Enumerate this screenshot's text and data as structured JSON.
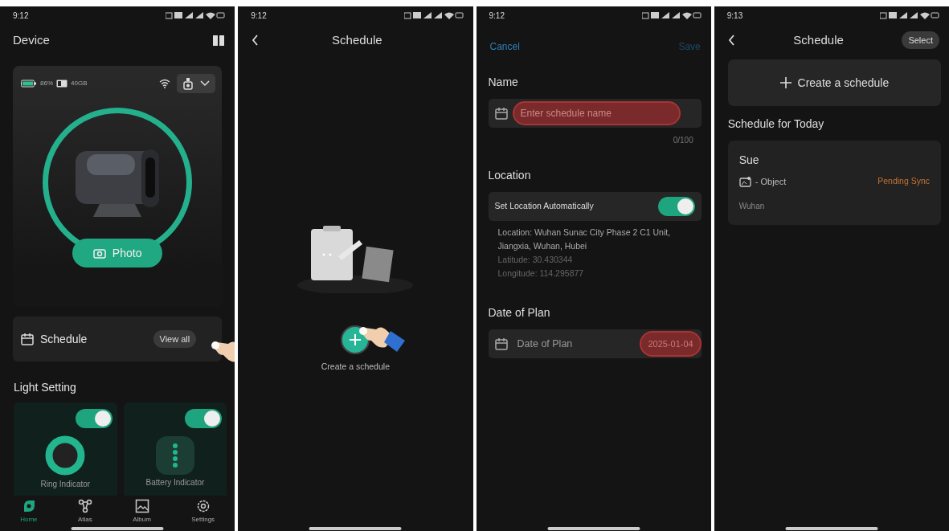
{
  "screens": [
    {
      "kind": "device",
      "status_time": "9:12",
      "title": "Device",
      "battery": "86%",
      "storage": "40GB",
      "photo_button": "Photo",
      "schedule": {
        "label": "Schedule",
        "action": "View all"
      },
      "light_heading": "Light Setting",
      "lights": [
        {
          "kind": "ring",
          "label": "Ring Indicator",
          "on": true
        },
        {
          "kind": "battery",
          "label": "Battery Indicator",
          "on": true
        }
      ],
      "nav": [
        {
          "kind": "home",
          "label": "Home",
          "selected": true
        },
        {
          "kind": "atlas",
          "label": "Atlas",
          "selected": false
        },
        {
          "kind": "album",
          "label": "Album",
          "selected": false
        },
        {
          "kind": "settings",
          "label": "Settings",
          "selected": false
        }
      ]
    },
    {
      "kind": "empty",
      "status_time": "9:12",
      "title": "Schedule",
      "create_label": "Create a schedule"
    },
    {
      "kind": "form",
      "status_time": "9:12",
      "cancel": "Cancel",
      "save": {
        "label": "Save",
        "disabled": true
      },
      "name": {
        "heading": "Name",
        "placeholder": "Enter schedule name",
        "highlighted": true,
        "counter": "0/100"
      },
      "location": {
        "heading": "Location",
        "toggle_label": "Set Location Automatically",
        "on": true,
        "lines": [
          {
            "text": "Location: Wuhan Sunac City Phase 2 C1 Unit, Jiangxia, Wuhan, Hubei",
            "dim": false
          },
          {
            "text": "Latitude: 30.430344",
            "dim": true
          },
          {
            "text": "Longitude: 114.295877",
            "dim": true
          }
        ]
      },
      "date": {
        "heading": "Date of Plan",
        "label": "Date of Plan",
        "value": "2025-01-04",
        "highlighted": true
      }
    },
    {
      "kind": "list",
      "status_time": "9:13",
      "title": "Schedule",
      "select": "Select",
      "create": "Create a schedule",
      "section": "Schedule for Today",
      "items": [
        {
          "title": "Sue",
          "type": "- Object",
          "status": "Pending Sync",
          "place": "Wuhan"
        }
      ]
    }
  ]
}
